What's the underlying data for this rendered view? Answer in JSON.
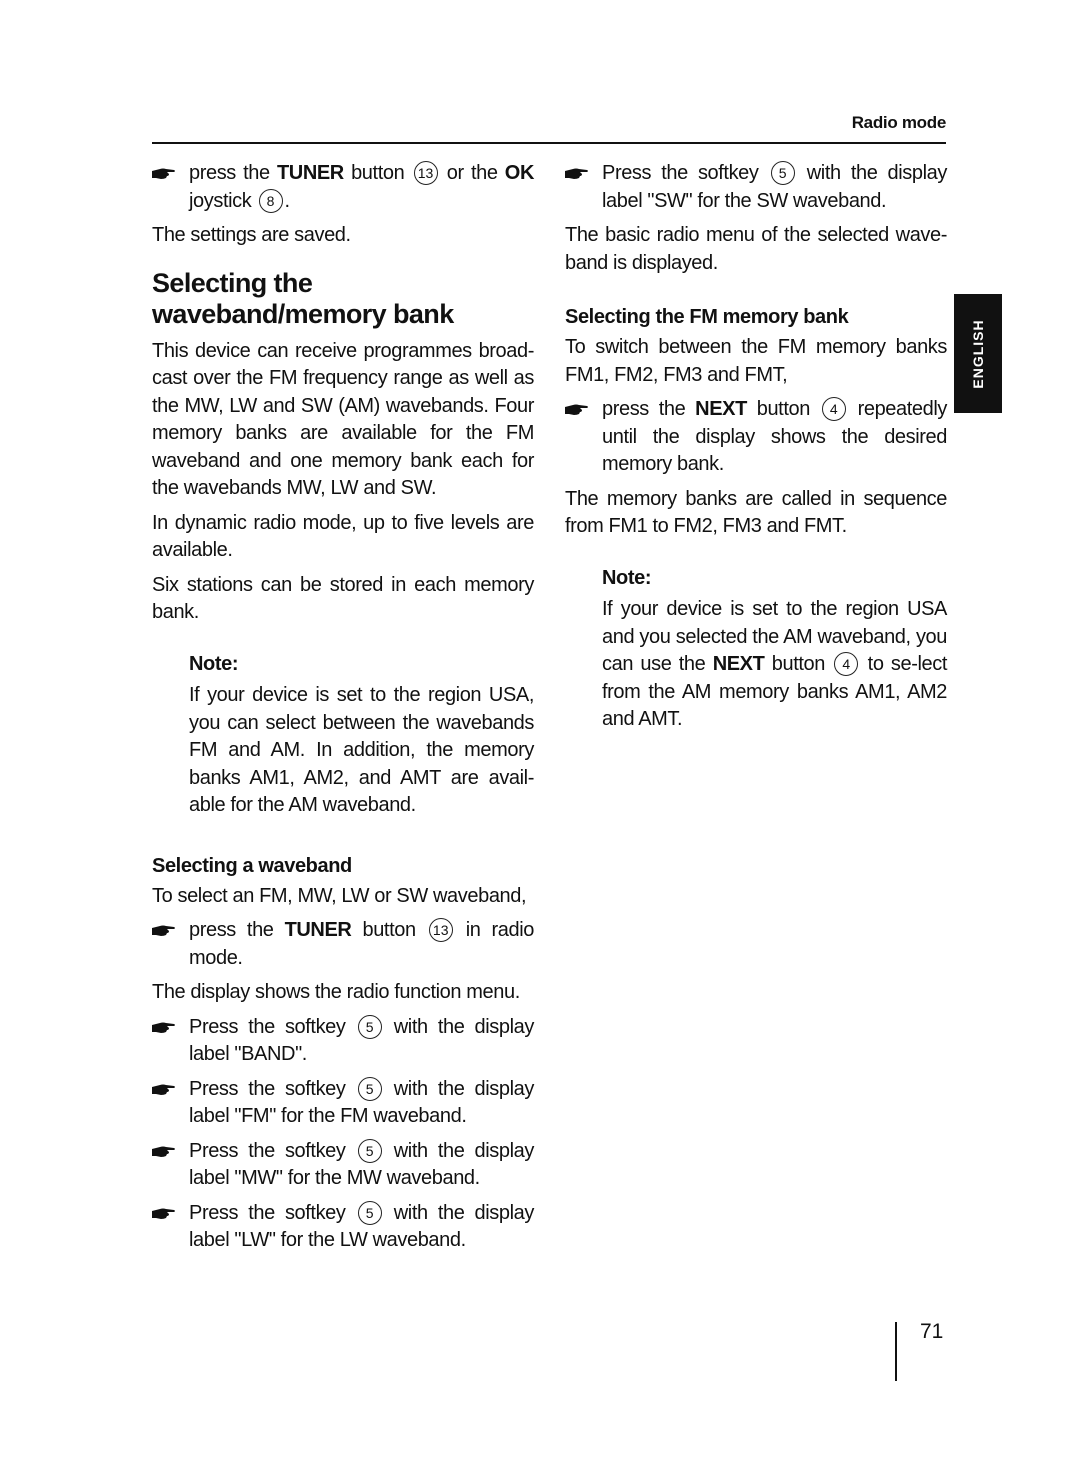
{
  "header": {
    "section_title": "Radio mode"
  },
  "language_tab": "ENGLISH",
  "page_number": "71",
  "left_column": {
    "intro_bullet": {
      "pre": "press the ",
      "bold1": "TUNER",
      "mid1": " button ",
      "num1": "13",
      "mid2": " or the ",
      "bold2": "OK",
      "mid3": " joystick ",
      "num2": "8",
      "post": "."
    },
    "saved_text": "The settings are saved.",
    "heading": "Selecting the waveband/memory bank",
    "para1": "This device can receive programmes broad-cast over the FM frequency range as well as the MW, LW and SW (AM) wavebands. Four memory banks are available for the FM waveband and one memory bank each for the wavebands MW, LW and SW.",
    "para2": "In dynamic radio mode, up to five levels are available.",
    "para3": "Six stations can be stored in each memory bank.",
    "note": {
      "title": "Note:",
      "text": "If your device is set to the region USA, you can select between the wavebands FM and AM. In addition, the memory banks AM1, AM2, and AMT are avail-able for the AM waveband."
    },
    "subheading": "Selecting a waveband",
    "select_intro": "To select an FM, MW, LW or SW waveband,",
    "tuner_bullet": {
      "pre": "press the ",
      "bold": "TUNER",
      "mid": " button ",
      "num": "13",
      "post": " in radio mode."
    },
    "display_text": "The display shows the radio function menu.",
    "softkey_bullets": [
      {
        "pre": "Press the softkey ",
        "num": "5",
        "post": " with the display label \"BAND\"."
      },
      {
        "pre": "Press the softkey ",
        "num": "5",
        "post": " with the display label \"FM\" for the FM waveband."
      },
      {
        "pre": "Press the softkey ",
        "num": "5",
        "post": " with the display label \"MW\" for the MW waveband."
      },
      {
        "pre": "Press the softkey ",
        "num": "5",
        "post": " with the display label \"LW\" for the LW waveband."
      }
    ]
  },
  "right_column": {
    "sw_bullet": {
      "pre": "Press the softkey ",
      "num": "5",
      "post": " with the display label \"SW\" for the SW waveband."
    },
    "basic_menu_text": "The basic radio menu of the selected wave-band is displayed.",
    "subheading": "Selecting the FM memory bank",
    "switch_text": "To switch between the FM memory banks FM1, FM2, FM3 and FMT,",
    "next_bullet": {
      "pre": "press the ",
      "bold": "NEXT",
      "mid": " button ",
      "num": "4",
      "post": " repeatedly until the display shows the desired memory bank."
    },
    "sequence_text": "The memory banks are called in sequence from FM1 to FM2, FM3 and FMT.",
    "note": {
      "title": "Note:",
      "pre": "If your device is set to the region USA and you selected the AM waveband, you can use the ",
      "bold": "NEXT",
      "mid": " button ",
      "num": "4",
      "post": " to se-lect from the AM memory banks AM1, AM2 and AMT."
    }
  }
}
